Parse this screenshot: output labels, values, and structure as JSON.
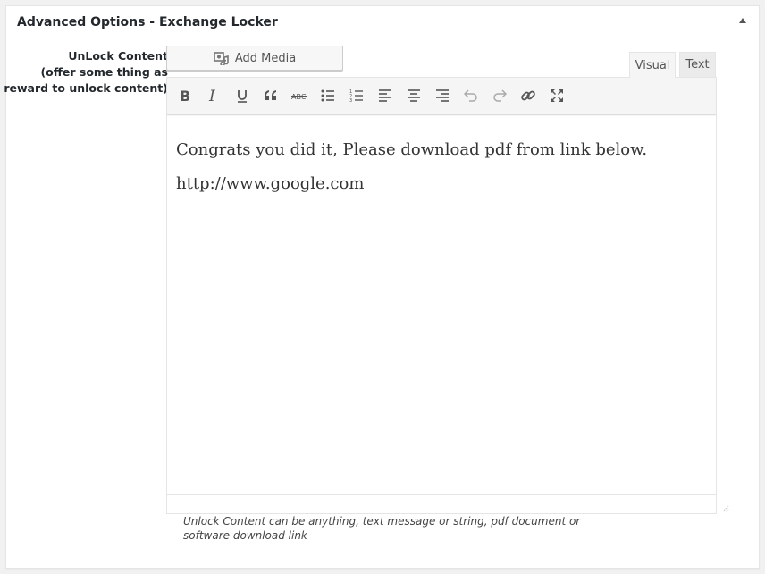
{
  "metabox": {
    "title": "Advanced Options - Exchange Locker",
    "toggle_icon": "arrow-up-icon"
  },
  "field": {
    "label_line1": "UnLock Content",
    "label_line2": "(offer some thing as",
    "label_line3": "reward to unlock content)"
  },
  "editor": {
    "add_media_label": "Add Media",
    "tabs": [
      {
        "label": "Visual",
        "active": true
      },
      {
        "label": "Text",
        "active": false
      }
    ],
    "toolbar": [
      {
        "name": "bold-icon"
      },
      {
        "name": "italic-icon"
      },
      {
        "name": "underline-icon"
      },
      {
        "name": "blockquote-icon"
      },
      {
        "name": "strikethrough-icon"
      },
      {
        "name": "bulleted-list-icon"
      },
      {
        "name": "numbered-list-icon"
      },
      {
        "name": "align-left-icon"
      },
      {
        "name": "align-center-icon"
      },
      {
        "name": "align-right-icon"
      },
      {
        "name": "undo-icon",
        "disabled": true
      },
      {
        "name": "redo-icon",
        "disabled": true
      },
      {
        "name": "insert-link-icon"
      },
      {
        "name": "fullscreen-icon"
      }
    ],
    "content": [
      "Congrats you did it, Please download pdf from link below.",
      "http://www.google.com"
    ]
  },
  "hint": "Unlock Content can be anything, text message or string, pdf document or software download link"
}
